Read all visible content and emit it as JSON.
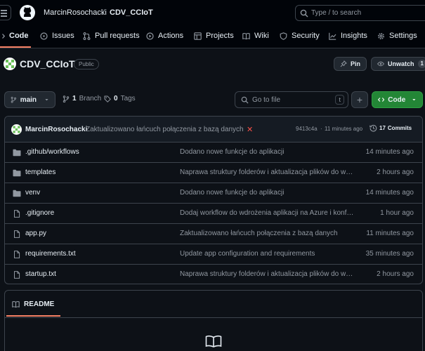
{
  "header": {
    "owner": "MarcinRosochacki",
    "separator": "/",
    "repo": "CDV_CCIoT",
    "search_placeholder": "Type / to search",
    "search_key": "/"
  },
  "nav_tabs": [
    {
      "label": "Code",
      "icon": "code-icon"
    },
    {
      "label": "Issues",
      "icon": "issue-opened-icon"
    },
    {
      "label": "Pull requests",
      "icon": "git-pull-request-icon"
    },
    {
      "label": "Actions",
      "icon": "play-icon"
    },
    {
      "label": "Projects",
      "icon": "table-icon"
    },
    {
      "label": "Wiki",
      "icon": "book-icon"
    },
    {
      "label": "Security",
      "icon": "shield-icon"
    },
    {
      "label": "Insights",
      "icon": "graph-icon"
    },
    {
      "label": "Settings",
      "icon": "gear-icon"
    }
  ],
  "repo_title": {
    "name": "CDV_CCIoT",
    "visibility": "Public",
    "pin_label": "Pin",
    "unwatch_label": "Unwatch",
    "watch_count": "1"
  },
  "toolbar": {
    "branch": "main",
    "branch_count": "1",
    "branch_label": "Branch",
    "tag_count": "0",
    "tag_label": "Tags",
    "go_to_file_placeholder": "Go to file",
    "go_to_file_key": "t",
    "add_label": "+",
    "code_label": "Code"
  },
  "commit": {
    "author": "MarcinRosochacki",
    "message": "Zaktualizowano łańcuch połączenia z bazą danych",
    "status": "✕",
    "hash": "9413c4a",
    "separator": "·",
    "time": "11 minutes ago",
    "commits_count": "17",
    "commits_label": "Commits"
  },
  "files": [
    {
      "name": ".github/workflows",
      "type": "folder",
      "message": "Dodano nowe funkcje do aplikacji",
      "time": "14 minutes ago"
    },
    {
      "name": "templates",
      "type": "folder",
      "message": "Naprawa struktury folderów i aktualizacja plików do wdrożenia",
      "time": "2 hours ago"
    },
    {
      "name": "venv",
      "type": "folder",
      "message": "Dodano nowe funkcje do aplikacji",
      "time": "14 minutes ago"
    },
    {
      "name": ".gitignore",
      "type": "file",
      "message": "Dodaj workflow do wdrożenia aplikacji na Azure i konfiguracji",
      "time": "1 hour ago"
    },
    {
      "name": "app.py",
      "type": "file",
      "message": "Zaktualizowano łańcuch połączenia z bazą danych",
      "time": "11 minutes ago"
    },
    {
      "name": "requirements.txt",
      "type": "file",
      "message": "Update app configuration and requirements",
      "time": "35 minutes ago"
    },
    {
      "name": "startup.txt",
      "type": "file",
      "message": "Naprawa struktury folderów i aktualizacja plików do wdrożenia",
      "time": "2 hours ago"
    }
  ],
  "readme": {
    "tab_label": "README"
  },
  "colors": {
    "background": "#0d1117",
    "header": "#010409",
    "border": "#3d444d",
    "accent_tab": "#f78166",
    "code_button": "#238636",
    "error": "#f85149"
  }
}
